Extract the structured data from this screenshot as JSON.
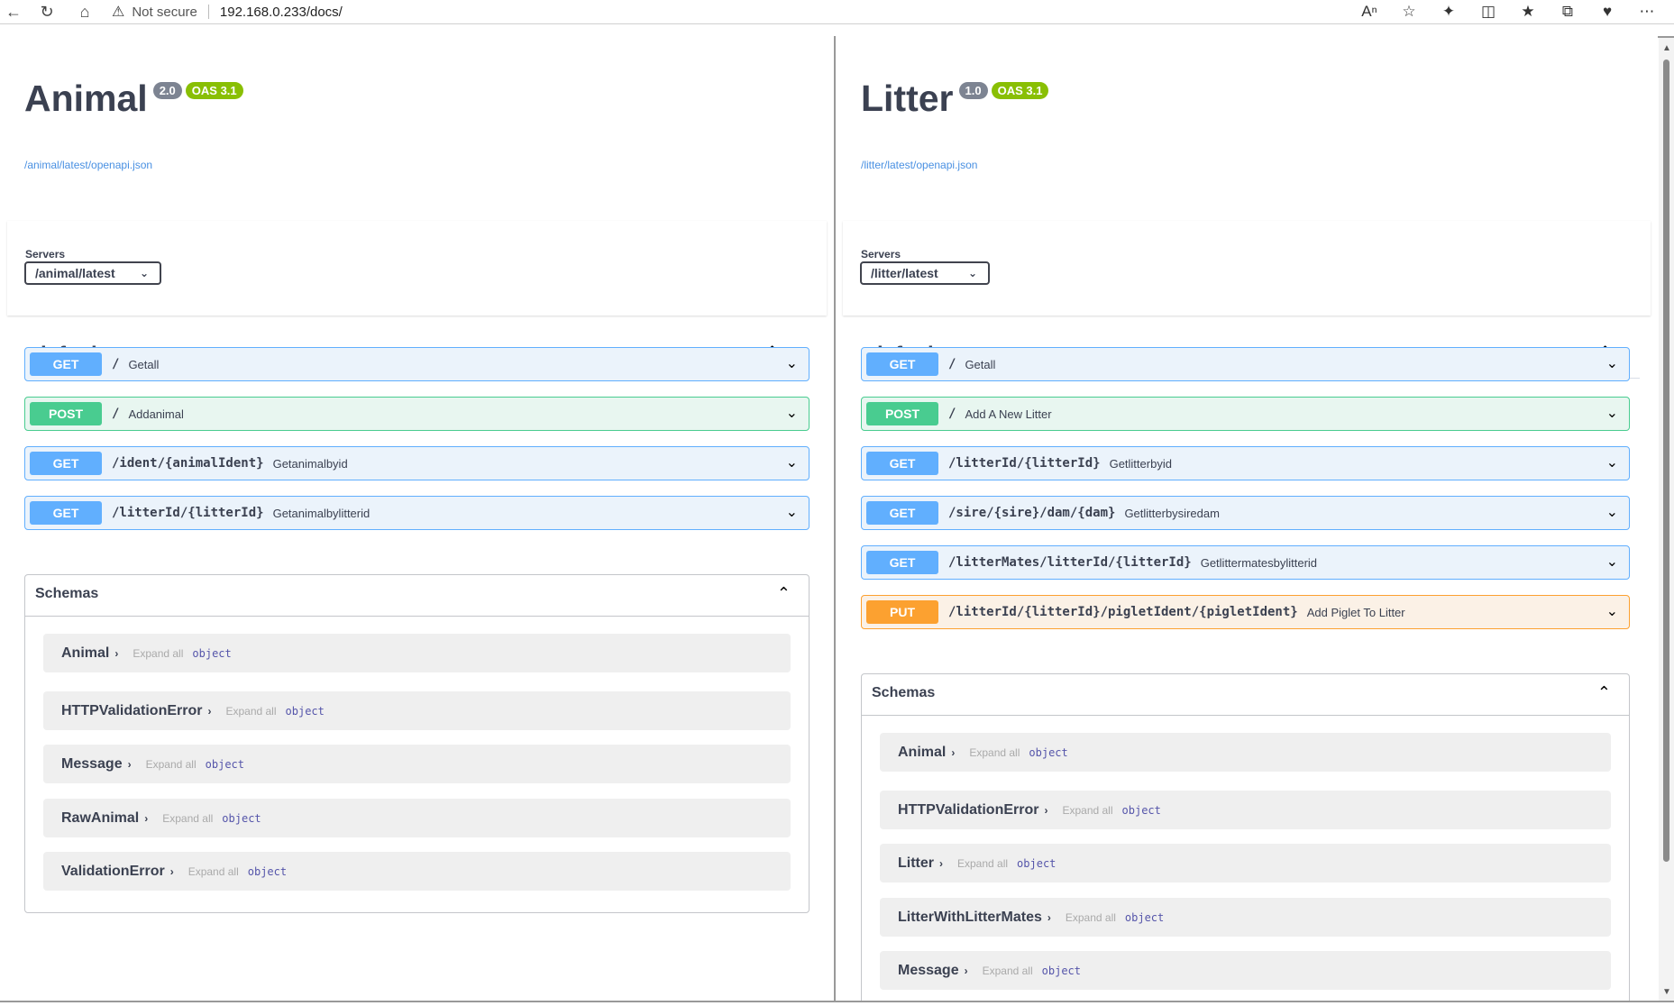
{
  "browser": {
    "security": "Not secure",
    "url": "192.168.0.233/docs/"
  },
  "panes": [
    {
      "title": "Animal",
      "version": "2.0",
      "oas": "OAS 3.1",
      "spec_url": "/animal/latest/openapi.json",
      "servers_label": "Servers",
      "server": "/animal/latest",
      "tag": "default",
      "operations": [
        {
          "method": "GET",
          "path": "/",
          "summary": "Getall"
        },
        {
          "method": "POST",
          "path": "/",
          "summary": "Addanimal"
        },
        {
          "method": "GET",
          "path": "/ident/{animalIdent}",
          "summary": "Getanimalbyid"
        },
        {
          "method": "GET",
          "path": "/litterId/{litterId}",
          "summary": "Getanimalbylitterid"
        }
      ],
      "schemas_title": "Schemas",
      "schemas": [
        {
          "name": "Animal",
          "expand": "Expand all",
          "type": "object"
        },
        {
          "name": "HTTPValidationError",
          "expand": "Expand all",
          "type": "object"
        },
        {
          "name": "Message",
          "expand": "Expand all",
          "type": "object"
        },
        {
          "name": "RawAnimal",
          "expand": "Expand all",
          "type": "object"
        },
        {
          "name": "ValidationError",
          "expand": "Expand all",
          "type": "object"
        }
      ]
    },
    {
      "title": "Litter",
      "version": "1.0",
      "oas": "OAS 3.1",
      "spec_url": "/litter/latest/openapi.json",
      "servers_label": "Servers",
      "server": "/litter/latest",
      "tag": "default",
      "operations": [
        {
          "method": "GET",
          "path": "/",
          "summary": "Getall"
        },
        {
          "method": "POST",
          "path": "/",
          "summary": "Add A New Litter"
        },
        {
          "method": "GET",
          "path": "/litterId/{litterId}",
          "summary": "Getlitterbyid"
        },
        {
          "method": "GET",
          "path": "/sire/{sire}/dam/{dam}",
          "summary": "Getlitterbysiredam"
        },
        {
          "method": "GET",
          "path": "/litterMates/litterId/{litterId}",
          "summary": "Getlittermatesbylitterid"
        },
        {
          "method": "PUT",
          "path": "/litterId/{litterId}/pigletIdent/{pigletIdent}",
          "summary": "Add Piglet To Litter"
        }
      ],
      "schemas_title": "Schemas",
      "schemas": [
        {
          "name": "Animal",
          "expand": "Expand all",
          "type": "object"
        },
        {
          "name": "HTTPValidationError",
          "expand": "Expand all",
          "type": "object"
        },
        {
          "name": "Litter",
          "expand": "Expand all",
          "type": "object"
        },
        {
          "name": "LitterWithLitterMates",
          "expand": "Expand all",
          "type": "object"
        },
        {
          "name": "Message",
          "expand": "Expand all",
          "type": "object"
        }
      ]
    }
  ]
}
